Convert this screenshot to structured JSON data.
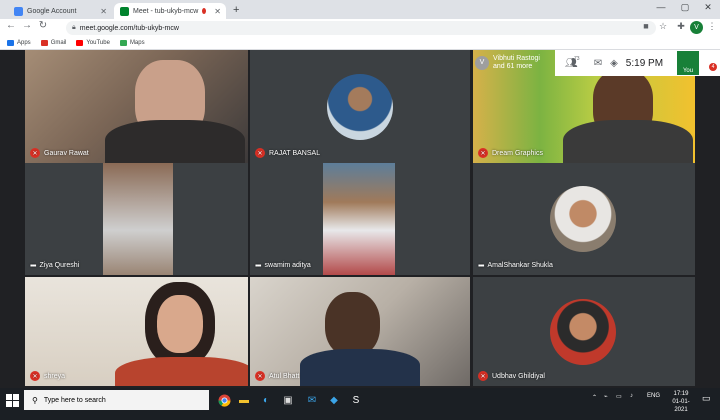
{
  "browser": {
    "tabs": [
      {
        "title": "Google Account",
        "active": false
      },
      {
        "title": "Meet - tub-ukyb-mcw",
        "active": true
      }
    ],
    "new_tab_icon": "plus-icon",
    "url": "meet.google.com/tub-ukyb-mcw",
    "profile_initial": "V",
    "bookmarks": [
      {
        "label": "Apps",
        "icon": "apps-grid-icon",
        "color": "#1a73e8"
      },
      {
        "label": "Gmail",
        "icon": "gmail-icon",
        "color": "#d93025"
      },
      {
        "label": "YouTube",
        "icon": "youtube-icon",
        "color": "#ff0000"
      },
      {
        "label": "Maps",
        "icon": "maps-icon",
        "color": "#34a853"
      }
    ]
  },
  "meet": {
    "presenter_initial": "V",
    "presenter_line1": "Vibhuti Rastogi",
    "presenter_line2": "and 61 more",
    "participants_count": "73",
    "time": "5:19 PM",
    "self_label": "You",
    "self_initial": "V",
    "self_badge": "4",
    "participants": [
      {
        "name": "Gaurav Rawat",
        "muted": true
      },
      {
        "name": "RAJAT BANSAL",
        "muted": true
      },
      {
        "name": "Dream Graphics",
        "muted": true
      },
      {
        "name": "Ziya Qureshi",
        "muted": true
      },
      {
        "name": "swamim aditya",
        "muted": false
      },
      {
        "name": "AmalShankar Shukla",
        "muted": false
      },
      {
        "name": "shreya",
        "muted": true
      },
      {
        "name": "Atul Bhatt",
        "muted": true
      },
      {
        "name": "Udbhav Ghildiyal",
        "muted": true
      }
    ]
  },
  "taskbar": {
    "search_placeholder": "Type here to search",
    "language": "ENG",
    "clock_time": "17:19",
    "clock_date": "01-01-2021"
  },
  "colors": {
    "muted": "#d93025",
    "meet_bg": "#202124",
    "accent_green": "#188038"
  }
}
